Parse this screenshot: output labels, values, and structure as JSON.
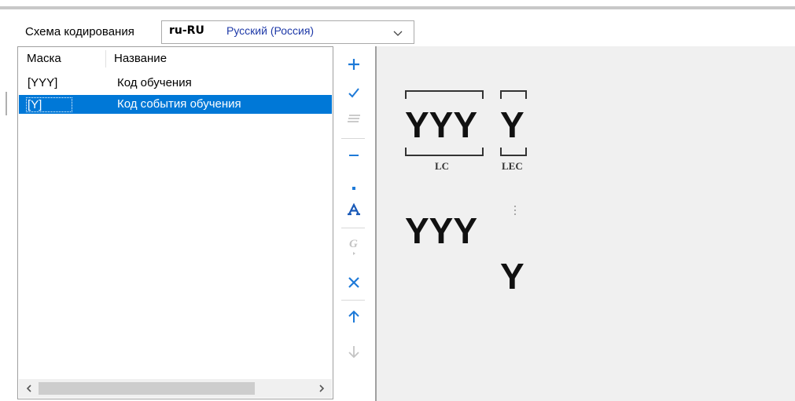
{
  "toolbar": {
    "scheme_label": "Схема кодирования",
    "scheme_code": "ru-RU",
    "scheme_name": "Русский (Россия)"
  },
  "list": {
    "columns": [
      "Маска",
      "Название"
    ],
    "rows": [
      {
        "mask": "[YYY]",
        "name": "Код обучения",
        "selected": false
      },
      {
        "mask": "[Y]",
        "name": "Код события обучения",
        "selected": true
      }
    ]
  },
  "side_buttons": [
    {
      "icon": "plus-icon",
      "enabled": true
    },
    {
      "icon": "check-icon",
      "enabled": true
    },
    {
      "icon": "lines-icon",
      "enabled": false
    },
    {
      "icon": "minus-icon",
      "enabled": true
    },
    {
      "icon": "dot-icon",
      "enabled": true
    },
    {
      "icon": "format-a-icon",
      "enabled": true
    },
    {
      "icon": "g-icon",
      "enabled": false
    },
    {
      "icon": "delete-x-icon",
      "enabled": true
    },
    {
      "icon": "arrow-up-icon",
      "enabled": true
    },
    {
      "icon": "arrow-down-icon",
      "enabled": false
    }
  ],
  "preview": {
    "segment1_text": "YYY",
    "segment1_caption": "LC",
    "segment2_text": "Y",
    "segment2_caption": "LEC",
    "stack_text_top": "YYY",
    "stack_text_bottom": "Y"
  },
  "colors": {
    "accent": "#0078d7",
    "icon_blue": "#1e7ad8",
    "disabled": "#c4c4c4",
    "preview_bg": "#f0f0f0"
  }
}
